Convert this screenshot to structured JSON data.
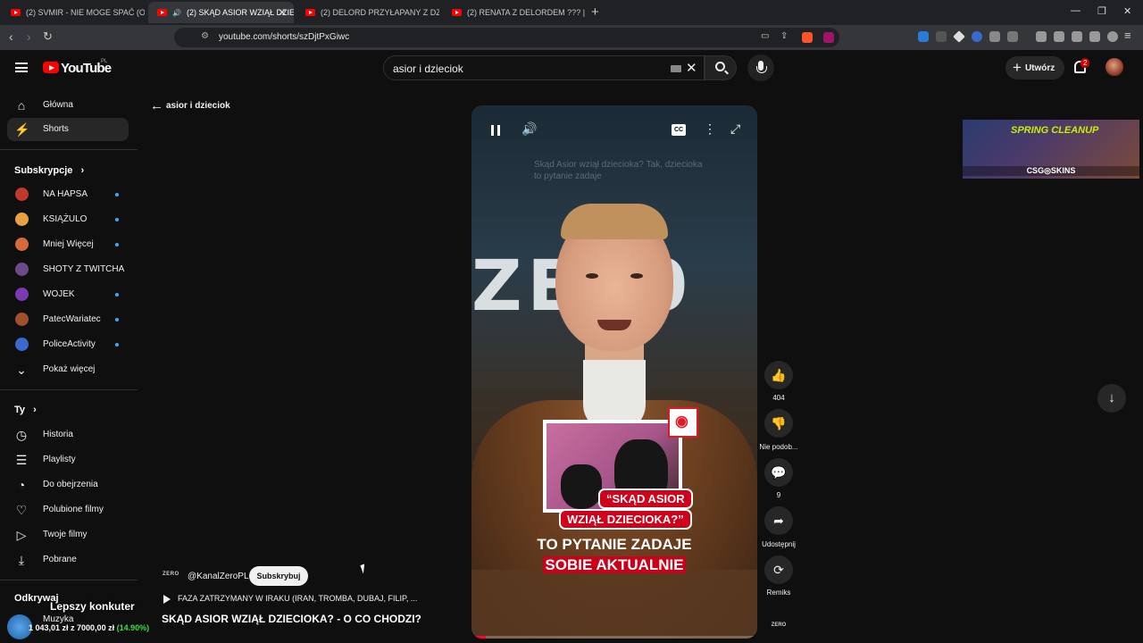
{
  "browser": {
    "tabs": [
      {
        "label": "(2) SVMIR - NIE MOGE SPAĆ (Official",
        "active": false
      },
      {
        "label": "(2) SKĄD ASIOR WZIĄŁ DZIEC",
        "active": true
      },
      {
        "label": "(2) DELORD PRZYŁAPANY Z DZIEWC",
        "active": false
      },
      {
        "label": "(2) RENATA Z DELORDEM ??? | DOBR",
        "active": false
      }
    ],
    "url": "youtube.com/shorts/szDjtPxGiwc",
    "new_tab": "+",
    "window": {
      "minimize": "—",
      "restore": "❐",
      "close": "✕"
    }
  },
  "header": {
    "logo_text": "YouTube",
    "region": "PL",
    "search_value": "asior i dzieciok",
    "create_label": "Utwórz",
    "notification_count": "2"
  },
  "sidebar": {
    "main": [
      {
        "label": "Główna",
        "icon": "home-icon",
        "glyph": "⌂"
      },
      {
        "label": "Shorts",
        "icon": "shorts-icon",
        "glyph": "⚡"
      }
    ],
    "subscriptions_title": "Subskrypcje",
    "subscriptions": [
      {
        "label": "NA HAPSA",
        "color": "#c0392b"
      },
      {
        "label": "KSIĄŻULO",
        "color": "#e8a040"
      },
      {
        "label": "Mniej Więcej",
        "color": "#d86a3a"
      },
      {
        "label": "SHOTY Z TWITCHA",
        "color": "#6a4a8a"
      },
      {
        "label": "WOJEK",
        "color": "#7a3ab0"
      },
      {
        "label": "PatecWariatec",
        "color": "#a0502a"
      },
      {
        "label": "PoliceActivity",
        "color": "#3a6ad0"
      }
    ],
    "show_more": "Pokaż więcej",
    "you_title": "Ty",
    "you_items": [
      {
        "label": "Historia",
        "icon": "history-icon",
        "glyph": "◷"
      },
      {
        "label": "Playlisty",
        "icon": "playlists-icon",
        "glyph": "☰"
      },
      {
        "label": "Do obejrzenia",
        "icon": "watch-later-icon",
        "glyph": "◔"
      },
      {
        "label": "Polubione filmy",
        "icon": "like-icon",
        "glyph": "👍"
      },
      {
        "label": "Twoje filmy",
        "icon": "your-videos-icon",
        "glyph": "▶"
      },
      {
        "label": "Pobrane",
        "icon": "download-icon",
        "glyph": "⤓"
      }
    ],
    "explore_title": "Odkrywaj",
    "explore_item": "Muzyka"
  },
  "main": {
    "back_label": "asior i dzieciok",
    "video": {
      "caption": "Skąd Asior wziął dzieciokа? Tak, dzieciokа to pytanie zadaje",
      "wall_text": "ZER0",
      "pill_line1": "“SKĄD ASIOR",
      "pill_line2": "WZIĄŁ DZIECIOKA?”",
      "headline1": "TO PYTANIE ZADAJE",
      "headline2": "SOBIE AKTUALNIE",
      "progress": 0.05
    },
    "channel_logo": "ZERO",
    "channel": "@KanalZeroPL",
    "subscribe": "Subskrybuj",
    "music": "FAZA ZATRZYMANY W IRAKU (IRAN, TROMBA, DUBAJ, FILIP, ...",
    "title": "SKĄD ASIOR WZIĄŁ DZIECIOKA? - O CO CHODZI?"
  },
  "rail": {
    "likes": "404",
    "dislike": "Nie podob...",
    "comments": "9",
    "share": "Udostępnij",
    "remix": "Remiks",
    "channel_chip": "ZERO"
  },
  "ad": {
    "title": "SPRING CLEANUP",
    "brand": "CSG◎SKINS"
  },
  "overlay": {
    "title": "Lepszy konkuter",
    "amount": "1 043,01 zł z 7000,00 zł",
    "percent": "(14.90%)"
  }
}
